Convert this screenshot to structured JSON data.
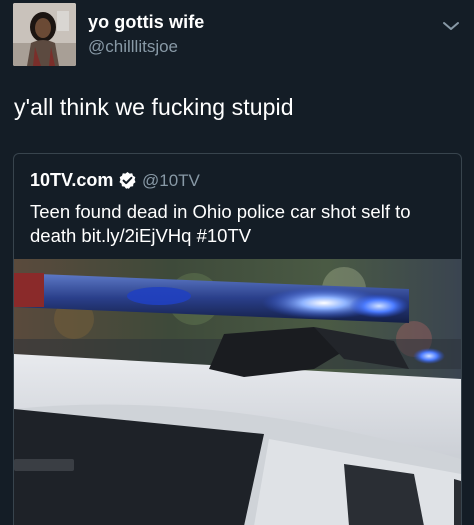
{
  "tweet": {
    "display_name": "yo gottis wife",
    "handle": "@chilllitsjoe",
    "text": "y'all think we fucking stupid",
    "menu_icon": "chevron-down-icon"
  },
  "quoted_tweet": {
    "display_name": "10TV.com",
    "verified_icon": "verified-badge-icon",
    "handle": "@10TV",
    "text": "Teen found dead in Ohio police car shot self to death bit.ly/2iEjVHq #10TV",
    "image_description_icon": "police-car-lightbar-photo"
  },
  "colors": {
    "background": "#141d26",
    "text_primary": "#ffffff",
    "text_secondary": "#8899a6",
    "card_border": "#38444d"
  }
}
